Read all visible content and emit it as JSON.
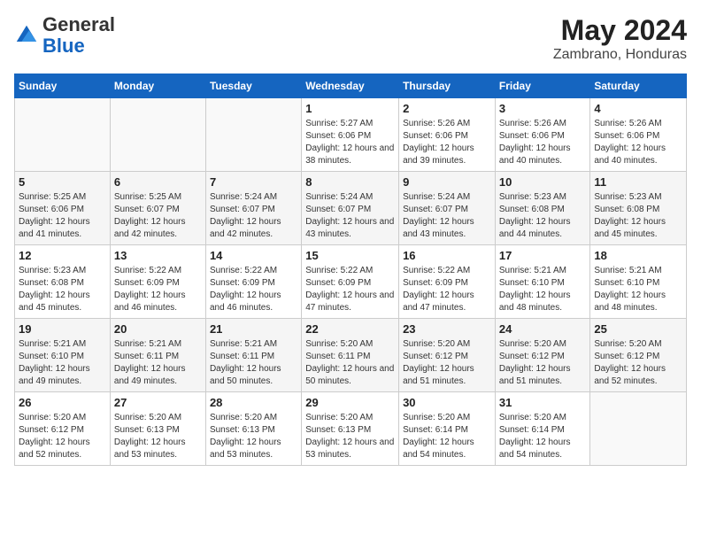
{
  "logo": {
    "general": "General",
    "blue": "Blue"
  },
  "header": {
    "month_year": "May 2024",
    "location": "Zambrano, Honduras"
  },
  "days_of_week": [
    "Sunday",
    "Monday",
    "Tuesday",
    "Wednesday",
    "Thursday",
    "Friday",
    "Saturday"
  ],
  "weeks": [
    [
      {
        "day": "",
        "info": ""
      },
      {
        "day": "",
        "info": ""
      },
      {
        "day": "",
        "info": ""
      },
      {
        "day": "1",
        "info": "Sunrise: 5:27 AM\nSunset: 6:06 PM\nDaylight: 12 hours and 38 minutes."
      },
      {
        "day": "2",
        "info": "Sunrise: 5:26 AM\nSunset: 6:06 PM\nDaylight: 12 hours and 39 minutes."
      },
      {
        "day": "3",
        "info": "Sunrise: 5:26 AM\nSunset: 6:06 PM\nDaylight: 12 hours and 40 minutes."
      },
      {
        "day": "4",
        "info": "Sunrise: 5:26 AM\nSunset: 6:06 PM\nDaylight: 12 hours and 40 minutes."
      }
    ],
    [
      {
        "day": "5",
        "info": "Sunrise: 5:25 AM\nSunset: 6:06 PM\nDaylight: 12 hours and 41 minutes."
      },
      {
        "day": "6",
        "info": "Sunrise: 5:25 AM\nSunset: 6:07 PM\nDaylight: 12 hours and 42 minutes."
      },
      {
        "day": "7",
        "info": "Sunrise: 5:24 AM\nSunset: 6:07 PM\nDaylight: 12 hours and 42 minutes."
      },
      {
        "day": "8",
        "info": "Sunrise: 5:24 AM\nSunset: 6:07 PM\nDaylight: 12 hours and 43 minutes."
      },
      {
        "day": "9",
        "info": "Sunrise: 5:24 AM\nSunset: 6:07 PM\nDaylight: 12 hours and 43 minutes."
      },
      {
        "day": "10",
        "info": "Sunrise: 5:23 AM\nSunset: 6:08 PM\nDaylight: 12 hours and 44 minutes."
      },
      {
        "day": "11",
        "info": "Sunrise: 5:23 AM\nSunset: 6:08 PM\nDaylight: 12 hours and 45 minutes."
      }
    ],
    [
      {
        "day": "12",
        "info": "Sunrise: 5:23 AM\nSunset: 6:08 PM\nDaylight: 12 hours and 45 minutes."
      },
      {
        "day": "13",
        "info": "Sunrise: 5:22 AM\nSunset: 6:09 PM\nDaylight: 12 hours and 46 minutes."
      },
      {
        "day": "14",
        "info": "Sunrise: 5:22 AM\nSunset: 6:09 PM\nDaylight: 12 hours and 46 minutes."
      },
      {
        "day": "15",
        "info": "Sunrise: 5:22 AM\nSunset: 6:09 PM\nDaylight: 12 hours and 47 minutes."
      },
      {
        "day": "16",
        "info": "Sunrise: 5:22 AM\nSunset: 6:09 PM\nDaylight: 12 hours and 47 minutes."
      },
      {
        "day": "17",
        "info": "Sunrise: 5:21 AM\nSunset: 6:10 PM\nDaylight: 12 hours and 48 minutes."
      },
      {
        "day": "18",
        "info": "Sunrise: 5:21 AM\nSunset: 6:10 PM\nDaylight: 12 hours and 48 minutes."
      }
    ],
    [
      {
        "day": "19",
        "info": "Sunrise: 5:21 AM\nSunset: 6:10 PM\nDaylight: 12 hours and 49 minutes."
      },
      {
        "day": "20",
        "info": "Sunrise: 5:21 AM\nSunset: 6:11 PM\nDaylight: 12 hours and 49 minutes."
      },
      {
        "day": "21",
        "info": "Sunrise: 5:21 AM\nSunset: 6:11 PM\nDaylight: 12 hours and 50 minutes."
      },
      {
        "day": "22",
        "info": "Sunrise: 5:20 AM\nSunset: 6:11 PM\nDaylight: 12 hours and 50 minutes."
      },
      {
        "day": "23",
        "info": "Sunrise: 5:20 AM\nSunset: 6:12 PM\nDaylight: 12 hours and 51 minutes."
      },
      {
        "day": "24",
        "info": "Sunrise: 5:20 AM\nSunset: 6:12 PM\nDaylight: 12 hours and 51 minutes."
      },
      {
        "day": "25",
        "info": "Sunrise: 5:20 AM\nSunset: 6:12 PM\nDaylight: 12 hours and 52 minutes."
      }
    ],
    [
      {
        "day": "26",
        "info": "Sunrise: 5:20 AM\nSunset: 6:12 PM\nDaylight: 12 hours and 52 minutes."
      },
      {
        "day": "27",
        "info": "Sunrise: 5:20 AM\nSunset: 6:13 PM\nDaylight: 12 hours and 53 minutes."
      },
      {
        "day": "28",
        "info": "Sunrise: 5:20 AM\nSunset: 6:13 PM\nDaylight: 12 hours and 53 minutes."
      },
      {
        "day": "29",
        "info": "Sunrise: 5:20 AM\nSunset: 6:13 PM\nDaylight: 12 hours and 53 minutes."
      },
      {
        "day": "30",
        "info": "Sunrise: 5:20 AM\nSunset: 6:14 PM\nDaylight: 12 hours and 54 minutes."
      },
      {
        "day": "31",
        "info": "Sunrise: 5:20 AM\nSunset: 6:14 PM\nDaylight: 12 hours and 54 minutes."
      },
      {
        "day": "",
        "info": ""
      }
    ]
  ]
}
